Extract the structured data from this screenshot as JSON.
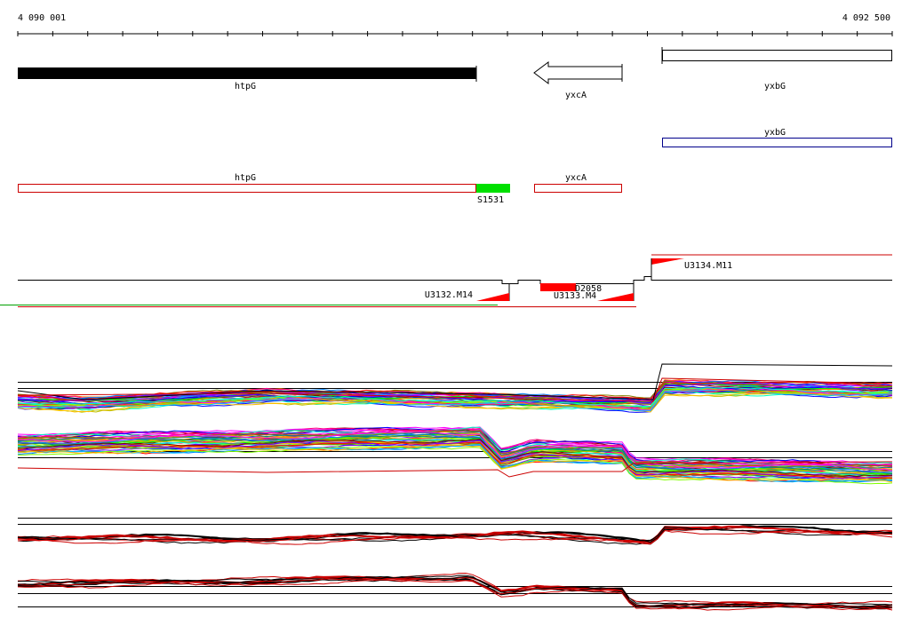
{
  "ruler": {
    "start_label": "4 090 001",
    "end_label": "4 092 500"
  },
  "genes": {
    "htpG": "htpG",
    "yxcA": "yxcA",
    "yxbG": "yxbG"
  },
  "transcribed_regions": {
    "yxbG": "yxbG",
    "htpG": "htpG",
    "yxcA": "yxcA",
    "S1531": "S1531"
  },
  "segments": {
    "U3134": "U3134.M11",
    "U3132": "U3132.M14",
    "U3133": "U3133.M4",
    "D2058": "D2058"
  },
  "colors": {
    "gene_fill": "#000000",
    "region_outline": "#cc0000",
    "utr_outline": "#00008b",
    "s1531_fill": "#00e000",
    "segment_red": "#ff0000",
    "green_line": "#00a000"
  },
  "profile_palette": [
    "#ff00ff",
    "#00c0ff",
    "#00ff00",
    "#ff8000",
    "#0000ff",
    "#ff0000",
    "#8000ff",
    "#00ffc0",
    "#c0c000",
    "#ff0080",
    "#0080ff",
    "#80ff00",
    "#800000",
    "#008080",
    "#808000",
    "#ffc000"
  ]
}
